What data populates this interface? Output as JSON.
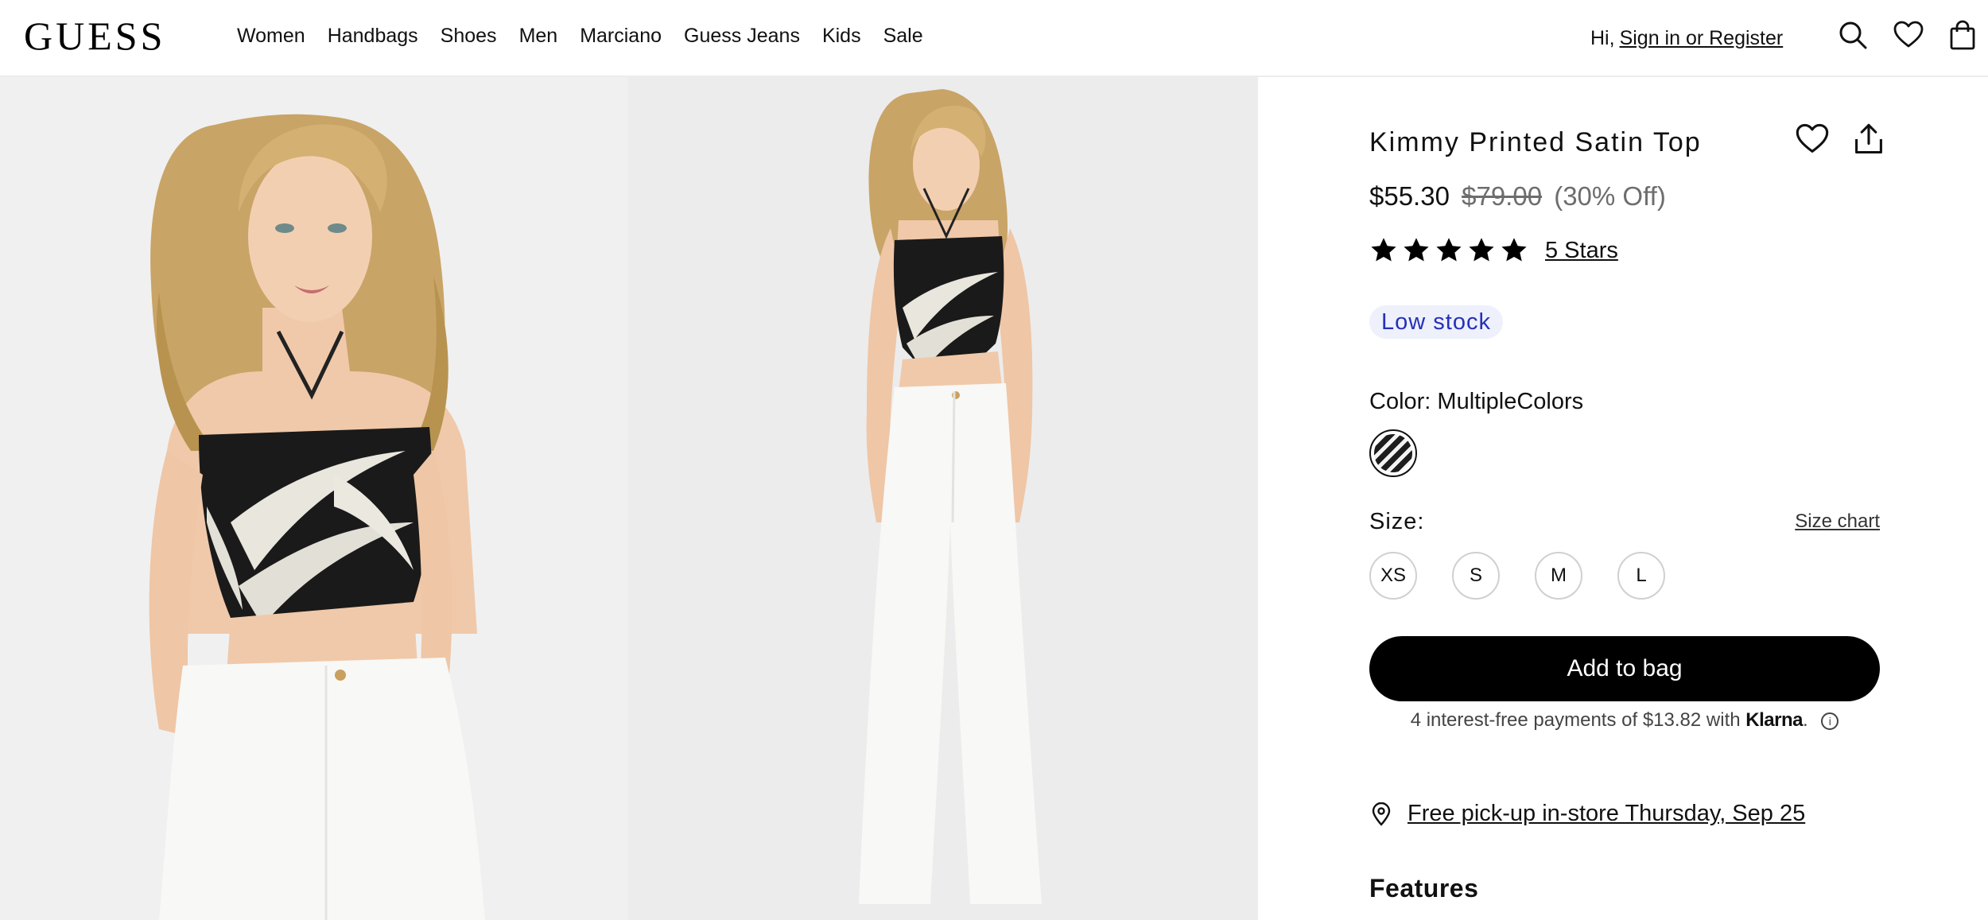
{
  "header": {
    "logo": "GUESS",
    "nav": [
      "Women",
      "Handbags",
      "Shoes",
      "Men",
      "Marciano",
      "Guess Jeans",
      "Kids",
      "Sale"
    ],
    "greeting": "Hi,",
    "signin": "Sign in or Register",
    "icons": [
      "search-icon",
      "heart-icon",
      "shopping-bag-icon"
    ]
  },
  "gallery": {
    "images": [
      "product-photo-front",
      "product-photo-full-length"
    ]
  },
  "product": {
    "title": "Kimmy Printed Satin Top",
    "price": "$55.30",
    "original_price": "$79.00",
    "discount": "(30% Off)",
    "rating": 5,
    "rating_label": "5 Stars",
    "stock_badge": "Low stock",
    "color_label": "Color: MultipleColors",
    "size_label": "Size:",
    "size_chart": "Size chart",
    "sizes": [
      "XS",
      "S",
      "M",
      "L"
    ],
    "add_to_bag": "Add to bag",
    "klarna_text": "4 interest-free payments of $13.82 with",
    "klarna_brand": "Klarna",
    "klarna_suffix": ".",
    "info_glyph": "i",
    "pickup": "Free pick-up in-store Thursday, Sep 25",
    "features_heading": "Features"
  },
  "colors": {
    "stock_badge_bg": "#eef0fb",
    "stock_badge_text": "#2431b8",
    "primary_button": "#000000"
  }
}
